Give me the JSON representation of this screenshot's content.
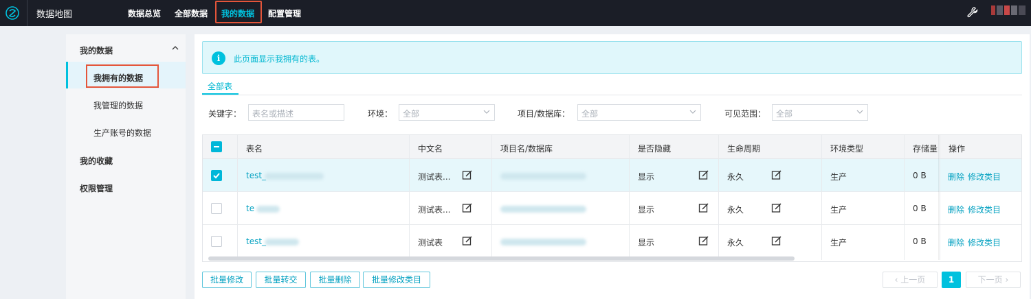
{
  "app": {
    "brand": "数据地图"
  },
  "nav": {
    "items": [
      "数据总览",
      "全部数据",
      "我的数据",
      "配置管理"
    ],
    "active": "我的数据"
  },
  "sidebar": {
    "groups": [
      {
        "label": "我的数据",
        "items": [
          "我拥有的数据",
          "我管理的数据",
          "生产账号的数据"
        ]
      },
      {
        "label": "我的收藏"
      },
      {
        "label": "权限管理"
      }
    ],
    "active_item": "我拥有的数据"
  },
  "info": {
    "text": "此页面显示我拥有的表。"
  },
  "tabs": [
    "全部表"
  ],
  "filters": {
    "keyword_label": "关键字：",
    "keyword_placeholder": "表名或描述",
    "env_label": "环境：",
    "env_value": "全部",
    "project_label": "项目/数据库：",
    "project_value": "全部",
    "scope_label": "可见范围：",
    "scope_value": "全部"
  },
  "table": {
    "headers": [
      "表名",
      "中文名",
      "项目名/数据库",
      "是否隐藏",
      "生命周期",
      "环境类型",
      "存储量",
      "操作"
    ],
    "rows": [
      {
        "name": "test_",
        "cn_name": "测试表...",
        "hidden": "显示",
        "lifecycle": "永久",
        "env": "生产",
        "storage": "0 B",
        "selected": true
      },
      {
        "name": "te",
        "cn_name": "测试表...",
        "hidden": "显示",
        "lifecycle": "永久",
        "env": "生产",
        "storage": "0 B",
        "selected": false
      },
      {
        "name": "test_",
        "cn_name": "测试表",
        "hidden": "显示",
        "lifecycle": "永久",
        "env": "生产",
        "storage": "0 B",
        "selected": false
      }
    ],
    "op_delete": "删除",
    "op_modify": "修改类目"
  },
  "bulk": {
    "modify": "批量修改",
    "transfer": "批量转交",
    "delete": "批量删除",
    "modify_category": "批量修改类目"
  },
  "pagination": {
    "prev": "上一页",
    "page": "1",
    "next": "下一页"
  },
  "colors": {
    "accent": "#00c1de",
    "topbar": "#1b1e27",
    "highlight": "#e4553a"
  }
}
